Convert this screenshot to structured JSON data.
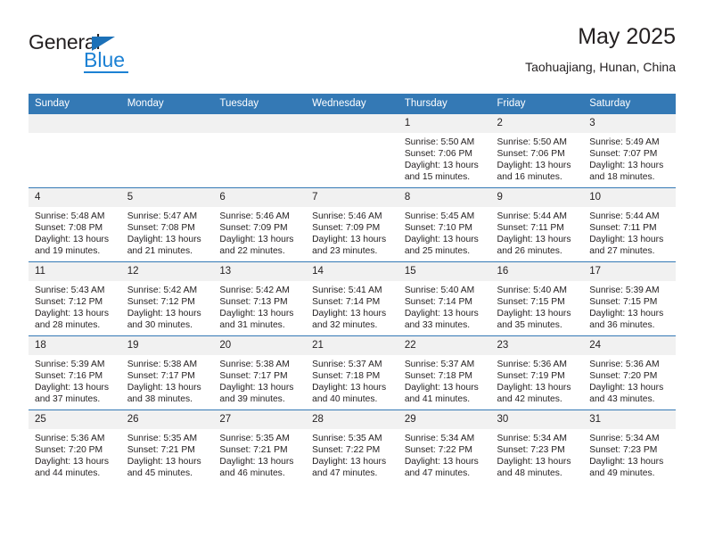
{
  "logo": {
    "word_one": "General",
    "word_two": "Blue",
    "triangle_icon": "triangle-icon"
  },
  "header": {
    "title": "May 2025",
    "subtitle": "Taohuajiang, Hunan, China"
  },
  "colors": {
    "header_blue": "#3479b5",
    "logo_blue": "#1c81d4",
    "daynum_bg": "#f1f1f1",
    "text": "#231f20"
  },
  "weekdays": [
    "Sunday",
    "Monday",
    "Tuesday",
    "Wednesday",
    "Thursday",
    "Friday",
    "Saturday"
  ],
  "weeks": [
    [
      {
        "day": "",
        "info": ""
      },
      {
        "day": "",
        "info": ""
      },
      {
        "day": "",
        "info": ""
      },
      {
        "day": "",
        "info": ""
      },
      {
        "day": "1",
        "info": "Sunrise: 5:50 AM\nSunset: 7:06 PM\nDaylight: 13 hours\nand 15 minutes."
      },
      {
        "day": "2",
        "info": "Sunrise: 5:50 AM\nSunset: 7:06 PM\nDaylight: 13 hours\nand 16 minutes."
      },
      {
        "day": "3",
        "info": "Sunrise: 5:49 AM\nSunset: 7:07 PM\nDaylight: 13 hours\nand 18 minutes."
      }
    ],
    [
      {
        "day": "4",
        "info": "Sunrise: 5:48 AM\nSunset: 7:08 PM\nDaylight: 13 hours\nand 19 minutes."
      },
      {
        "day": "5",
        "info": "Sunrise: 5:47 AM\nSunset: 7:08 PM\nDaylight: 13 hours\nand 21 minutes."
      },
      {
        "day": "6",
        "info": "Sunrise: 5:46 AM\nSunset: 7:09 PM\nDaylight: 13 hours\nand 22 minutes."
      },
      {
        "day": "7",
        "info": "Sunrise: 5:46 AM\nSunset: 7:09 PM\nDaylight: 13 hours\nand 23 minutes."
      },
      {
        "day": "8",
        "info": "Sunrise: 5:45 AM\nSunset: 7:10 PM\nDaylight: 13 hours\nand 25 minutes."
      },
      {
        "day": "9",
        "info": "Sunrise: 5:44 AM\nSunset: 7:11 PM\nDaylight: 13 hours\nand 26 minutes."
      },
      {
        "day": "10",
        "info": "Sunrise: 5:44 AM\nSunset: 7:11 PM\nDaylight: 13 hours\nand 27 minutes."
      }
    ],
    [
      {
        "day": "11",
        "info": "Sunrise: 5:43 AM\nSunset: 7:12 PM\nDaylight: 13 hours\nand 28 minutes."
      },
      {
        "day": "12",
        "info": "Sunrise: 5:42 AM\nSunset: 7:12 PM\nDaylight: 13 hours\nand 30 minutes."
      },
      {
        "day": "13",
        "info": "Sunrise: 5:42 AM\nSunset: 7:13 PM\nDaylight: 13 hours\nand 31 minutes."
      },
      {
        "day": "14",
        "info": "Sunrise: 5:41 AM\nSunset: 7:14 PM\nDaylight: 13 hours\nand 32 minutes."
      },
      {
        "day": "15",
        "info": "Sunrise: 5:40 AM\nSunset: 7:14 PM\nDaylight: 13 hours\nand 33 minutes."
      },
      {
        "day": "16",
        "info": "Sunrise: 5:40 AM\nSunset: 7:15 PM\nDaylight: 13 hours\nand 35 minutes."
      },
      {
        "day": "17",
        "info": "Sunrise: 5:39 AM\nSunset: 7:15 PM\nDaylight: 13 hours\nand 36 minutes."
      }
    ],
    [
      {
        "day": "18",
        "info": "Sunrise: 5:39 AM\nSunset: 7:16 PM\nDaylight: 13 hours\nand 37 minutes."
      },
      {
        "day": "19",
        "info": "Sunrise: 5:38 AM\nSunset: 7:17 PM\nDaylight: 13 hours\nand 38 minutes."
      },
      {
        "day": "20",
        "info": "Sunrise: 5:38 AM\nSunset: 7:17 PM\nDaylight: 13 hours\nand 39 minutes."
      },
      {
        "day": "21",
        "info": "Sunrise: 5:37 AM\nSunset: 7:18 PM\nDaylight: 13 hours\nand 40 minutes."
      },
      {
        "day": "22",
        "info": "Sunrise: 5:37 AM\nSunset: 7:18 PM\nDaylight: 13 hours\nand 41 minutes."
      },
      {
        "day": "23",
        "info": "Sunrise: 5:36 AM\nSunset: 7:19 PM\nDaylight: 13 hours\nand 42 minutes."
      },
      {
        "day": "24",
        "info": "Sunrise: 5:36 AM\nSunset: 7:20 PM\nDaylight: 13 hours\nand 43 minutes."
      }
    ],
    [
      {
        "day": "25",
        "info": "Sunrise: 5:36 AM\nSunset: 7:20 PM\nDaylight: 13 hours\nand 44 minutes."
      },
      {
        "day": "26",
        "info": "Sunrise: 5:35 AM\nSunset: 7:21 PM\nDaylight: 13 hours\nand 45 minutes."
      },
      {
        "day": "27",
        "info": "Sunrise: 5:35 AM\nSunset: 7:21 PM\nDaylight: 13 hours\nand 46 minutes."
      },
      {
        "day": "28",
        "info": "Sunrise: 5:35 AM\nSunset: 7:22 PM\nDaylight: 13 hours\nand 47 minutes."
      },
      {
        "day": "29",
        "info": "Sunrise: 5:34 AM\nSunset: 7:22 PM\nDaylight: 13 hours\nand 47 minutes."
      },
      {
        "day": "30",
        "info": "Sunrise: 5:34 AM\nSunset: 7:23 PM\nDaylight: 13 hours\nand 48 minutes."
      },
      {
        "day": "31",
        "info": "Sunrise: 5:34 AM\nSunset: 7:23 PM\nDaylight: 13 hours\nand 49 minutes."
      }
    ]
  ]
}
